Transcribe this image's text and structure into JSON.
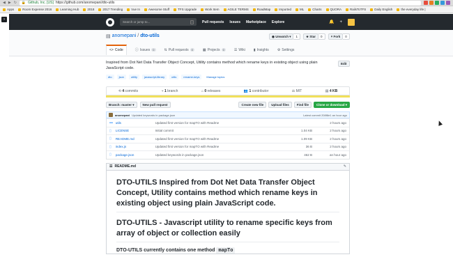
{
  "browser": {
    "url_org": "Github, Inc. [US]",
    "url": "https://github.com/anomepani/dto-utils",
    "bookmarks": [
      "Apps",
      "Room Expense 2016",
      "Learning Hub",
      "2018",
      "2017 Trending",
      "Vue In",
      "Awesome Stuff",
      "TFS Upgrade",
      "Work Item",
      "AGILE TERMS",
      "RoadMap",
      "Imported",
      "ML",
      "Charts",
      "QUORA",
      "RailsToTFS",
      "Daily English",
      "the everyday life |"
    ]
  },
  "header": {
    "search_placeholder": "Search or jump to...",
    "search_key": "/",
    "nav": [
      "Pull requests",
      "Issues",
      "Marketplace",
      "Explore"
    ],
    "plus": "+",
    "bell": "🔔"
  },
  "repo": {
    "owner": "anomepani",
    "sep": "/",
    "name": "dto-utils",
    "unwatch_label": "Unwatch",
    "unwatch_count": "1",
    "star_label": "Star",
    "star_count": "0",
    "fork_label": "Fork",
    "fork_count": "0",
    "tabs": [
      {
        "label": "Code",
        "count": ""
      },
      {
        "label": "Issues",
        "count": "0"
      },
      {
        "label": "Pull requests",
        "count": "0"
      },
      {
        "label": "Projects",
        "count": "0"
      },
      {
        "label": "Wiki",
        "count": ""
      },
      {
        "label": "Insights",
        "count": ""
      },
      {
        "label": "Settings",
        "count": ""
      }
    ]
  },
  "about": {
    "description": "Inspired from Dot Net Data Transfer Object Concept, Utility contains method which rename keys in existing object using plain JavaScript code.",
    "edit_label": "Edit",
    "topics": [
      "dto",
      "json",
      "utility",
      "javascript-library",
      "utils",
      "rename-keys"
    ],
    "manage_topics": "Manage topics"
  },
  "numbers": {
    "commits": "4",
    "commits_label": "commits",
    "branches": "1",
    "branches_label": "branch",
    "releases": "0",
    "releases_label": "releases",
    "contributors": "1",
    "contributors_label": "contributor",
    "license": "MIT",
    "size": "4 KB"
  },
  "fileops": {
    "branch": "Branch: master ▾",
    "new_pr": "New pull request",
    "create_file": "Create new file",
    "upload": "Upload files",
    "find": "Find file",
    "clone": "Clone or download ▾"
  },
  "commit": {
    "author": "anomepani",
    "message": "Updated keywords in package.json",
    "latest": "Latest commit 208f8e1 an hour ago"
  },
  "files": [
    {
      "type": "dir",
      "name": "utils",
      "message": "Updated first version for mapTO with Readme",
      "size": "",
      "age": "2 hours ago"
    },
    {
      "type": "file",
      "name": "LICENSE",
      "message": "Initial commit",
      "size": "1.04 KB",
      "age": "2 hours ago"
    },
    {
      "type": "file",
      "name": "README.md",
      "message": "Updated first version for mapTO with Readme",
      "size": "1.09 KB",
      "age": "2 hours ago"
    },
    {
      "type": "file",
      "name": "index.js",
      "message": "Updated first version for mapTO with Readme",
      "size": "36 B",
      "age": "2 hours ago"
    },
    {
      "type": "file",
      "name": "package.json",
      "message": "Updated keywords in package.json",
      "size": "462 B",
      "age": "an hour ago"
    }
  ],
  "readme": {
    "title": "README.md",
    "h1": "DTO-UTILS Inspired from Dot Net Data Transfer Object Concept, Utility contains method which rename keys in existing object using plain JavaScript code.",
    "h2": "DTO-UTILS - Javascript utility to rename specific keys from array of object or collection easily",
    "p_prefix": "DTO-UTILS currently contains one method",
    "p_code": "mapTo"
  },
  "colors": {
    "header_bg": "#24292e",
    "link": "#0366d6",
    "accent": "#e36209",
    "lang_bar": "#f1e05a",
    "green": "#28a745"
  }
}
